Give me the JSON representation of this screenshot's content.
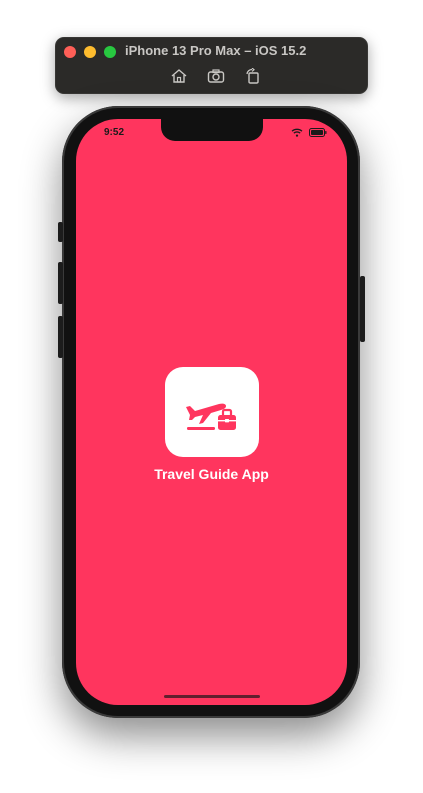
{
  "simulator": {
    "title": "iPhone 13 Pro Max – iOS 15.2",
    "toolbar": {
      "home_icon": "home-icon",
      "screenshot_icon": "camera-icon",
      "rotate_icon": "rotate-icon"
    }
  },
  "status_bar": {
    "time": "9:52",
    "wifi_icon": "wifi-icon",
    "battery_icon": "battery-icon"
  },
  "splash": {
    "app_name": "Travel Guide App",
    "logo_icon": "plane-luggage-icon",
    "background_color": "#ff355e",
    "icon_background": "#ffffff"
  }
}
